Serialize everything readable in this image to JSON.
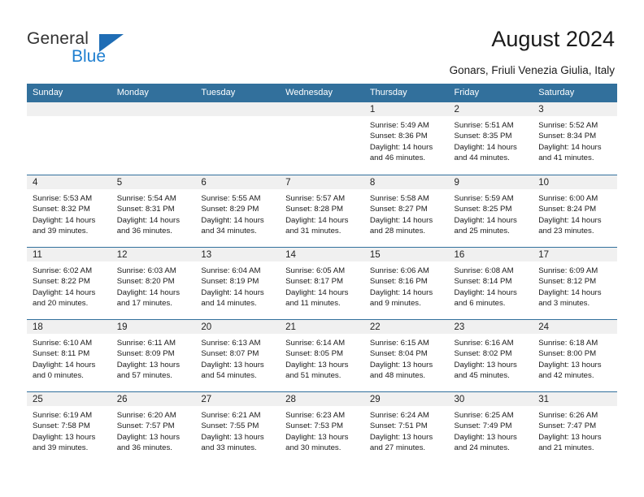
{
  "brand": {
    "word_one": "General",
    "word_two": "Blue",
    "accent_color": "#1f7fd0",
    "triangle_color": "#1f6db5"
  },
  "header": {
    "title": "August 2024",
    "subtitle": "Gonars, Friuli Venezia Giulia, Italy"
  },
  "calendar": {
    "header_bg": "#32709c",
    "day_headers": [
      "Sunday",
      "Monday",
      "Tuesday",
      "Wednesday",
      "Thursday",
      "Friday",
      "Saturday"
    ],
    "labels": {
      "sunrise": "Sunrise:",
      "sunset": "Sunset:",
      "daylight": "Daylight:"
    },
    "weeks": [
      [
        {
          "day": "",
          "empty": true
        },
        {
          "day": "",
          "empty": true
        },
        {
          "day": "",
          "empty": true
        },
        {
          "day": "",
          "empty": true
        },
        {
          "day": "1",
          "sunrise": "Sunrise: 5:49 AM",
          "sunset": "Sunset: 8:36 PM",
          "daylight_line1": "Daylight: 14 hours",
          "daylight_line2": "and 46 minutes."
        },
        {
          "day": "2",
          "sunrise": "Sunrise: 5:51 AM",
          "sunset": "Sunset: 8:35 PM",
          "daylight_line1": "Daylight: 14 hours",
          "daylight_line2": "and 44 minutes."
        },
        {
          "day": "3",
          "sunrise": "Sunrise: 5:52 AM",
          "sunset": "Sunset: 8:34 PM",
          "daylight_line1": "Daylight: 14 hours",
          "daylight_line2": "and 41 minutes."
        }
      ],
      [
        {
          "day": "4",
          "sunrise": "Sunrise: 5:53 AM",
          "sunset": "Sunset: 8:32 PM",
          "daylight_line1": "Daylight: 14 hours",
          "daylight_line2": "and 39 minutes."
        },
        {
          "day": "5",
          "sunrise": "Sunrise: 5:54 AM",
          "sunset": "Sunset: 8:31 PM",
          "daylight_line1": "Daylight: 14 hours",
          "daylight_line2": "and 36 minutes."
        },
        {
          "day": "6",
          "sunrise": "Sunrise: 5:55 AM",
          "sunset": "Sunset: 8:29 PM",
          "daylight_line1": "Daylight: 14 hours",
          "daylight_line2": "and 34 minutes."
        },
        {
          "day": "7",
          "sunrise": "Sunrise: 5:57 AM",
          "sunset": "Sunset: 8:28 PM",
          "daylight_line1": "Daylight: 14 hours",
          "daylight_line2": "and 31 minutes."
        },
        {
          "day": "8",
          "sunrise": "Sunrise: 5:58 AM",
          "sunset": "Sunset: 8:27 PM",
          "daylight_line1": "Daylight: 14 hours",
          "daylight_line2": "and 28 minutes."
        },
        {
          "day": "9",
          "sunrise": "Sunrise: 5:59 AM",
          "sunset": "Sunset: 8:25 PM",
          "daylight_line1": "Daylight: 14 hours",
          "daylight_line2": "and 25 minutes."
        },
        {
          "day": "10",
          "sunrise": "Sunrise: 6:00 AM",
          "sunset": "Sunset: 8:24 PM",
          "daylight_line1": "Daylight: 14 hours",
          "daylight_line2": "and 23 minutes."
        }
      ],
      [
        {
          "day": "11",
          "sunrise": "Sunrise: 6:02 AM",
          "sunset": "Sunset: 8:22 PM",
          "daylight_line1": "Daylight: 14 hours",
          "daylight_line2": "and 20 minutes."
        },
        {
          "day": "12",
          "sunrise": "Sunrise: 6:03 AM",
          "sunset": "Sunset: 8:20 PM",
          "daylight_line1": "Daylight: 14 hours",
          "daylight_line2": "and 17 minutes."
        },
        {
          "day": "13",
          "sunrise": "Sunrise: 6:04 AM",
          "sunset": "Sunset: 8:19 PM",
          "daylight_line1": "Daylight: 14 hours",
          "daylight_line2": "and 14 minutes."
        },
        {
          "day": "14",
          "sunrise": "Sunrise: 6:05 AM",
          "sunset": "Sunset: 8:17 PM",
          "daylight_line1": "Daylight: 14 hours",
          "daylight_line2": "and 11 minutes."
        },
        {
          "day": "15",
          "sunrise": "Sunrise: 6:06 AM",
          "sunset": "Sunset: 8:16 PM",
          "daylight_line1": "Daylight: 14 hours",
          "daylight_line2": "and 9 minutes."
        },
        {
          "day": "16",
          "sunrise": "Sunrise: 6:08 AM",
          "sunset": "Sunset: 8:14 PM",
          "daylight_line1": "Daylight: 14 hours",
          "daylight_line2": "and 6 minutes."
        },
        {
          "day": "17",
          "sunrise": "Sunrise: 6:09 AM",
          "sunset": "Sunset: 8:12 PM",
          "daylight_line1": "Daylight: 14 hours",
          "daylight_line2": "and 3 minutes."
        }
      ],
      [
        {
          "day": "18",
          "sunrise": "Sunrise: 6:10 AM",
          "sunset": "Sunset: 8:11 PM",
          "daylight_line1": "Daylight: 14 hours",
          "daylight_line2": "and 0 minutes."
        },
        {
          "day": "19",
          "sunrise": "Sunrise: 6:11 AM",
          "sunset": "Sunset: 8:09 PM",
          "daylight_line1": "Daylight: 13 hours",
          "daylight_line2": "and 57 minutes."
        },
        {
          "day": "20",
          "sunrise": "Sunrise: 6:13 AM",
          "sunset": "Sunset: 8:07 PM",
          "daylight_line1": "Daylight: 13 hours",
          "daylight_line2": "and 54 minutes."
        },
        {
          "day": "21",
          "sunrise": "Sunrise: 6:14 AM",
          "sunset": "Sunset: 8:05 PM",
          "daylight_line1": "Daylight: 13 hours",
          "daylight_line2": "and 51 minutes."
        },
        {
          "day": "22",
          "sunrise": "Sunrise: 6:15 AM",
          "sunset": "Sunset: 8:04 PM",
          "daylight_line1": "Daylight: 13 hours",
          "daylight_line2": "and 48 minutes."
        },
        {
          "day": "23",
          "sunrise": "Sunrise: 6:16 AM",
          "sunset": "Sunset: 8:02 PM",
          "daylight_line1": "Daylight: 13 hours",
          "daylight_line2": "and 45 minutes."
        },
        {
          "day": "24",
          "sunrise": "Sunrise: 6:18 AM",
          "sunset": "Sunset: 8:00 PM",
          "daylight_line1": "Daylight: 13 hours",
          "daylight_line2": "and 42 minutes."
        }
      ],
      [
        {
          "day": "25",
          "sunrise": "Sunrise: 6:19 AM",
          "sunset": "Sunset: 7:58 PM",
          "daylight_line1": "Daylight: 13 hours",
          "daylight_line2": "and 39 minutes."
        },
        {
          "day": "26",
          "sunrise": "Sunrise: 6:20 AM",
          "sunset": "Sunset: 7:57 PM",
          "daylight_line1": "Daylight: 13 hours",
          "daylight_line2": "and 36 minutes."
        },
        {
          "day": "27",
          "sunrise": "Sunrise: 6:21 AM",
          "sunset": "Sunset: 7:55 PM",
          "daylight_line1": "Daylight: 13 hours",
          "daylight_line2": "and 33 minutes."
        },
        {
          "day": "28",
          "sunrise": "Sunrise: 6:23 AM",
          "sunset": "Sunset: 7:53 PM",
          "daylight_line1": "Daylight: 13 hours",
          "daylight_line2": "and 30 minutes."
        },
        {
          "day": "29",
          "sunrise": "Sunrise: 6:24 AM",
          "sunset": "Sunset: 7:51 PM",
          "daylight_line1": "Daylight: 13 hours",
          "daylight_line2": "and 27 minutes."
        },
        {
          "day": "30",
          "sunrise": "Sunrise: 6:25 AM",
          "sunset": "Sunset: 7:49 PM",
          "daylight_line1": "Daylight: 13 hours",
          "daylight_line2": "and 24 minutes."
        },
        {
          "day": "31",
          "sunrise": "Sunrise: 6:26 AM",
          "sunset": "Sunset: 7:47 PM",
          "daylight_line1": "Daylight: 13 hours",
          "daylight_line2": "and 21 minutes."
        }
      ]
    ]
  }
}
